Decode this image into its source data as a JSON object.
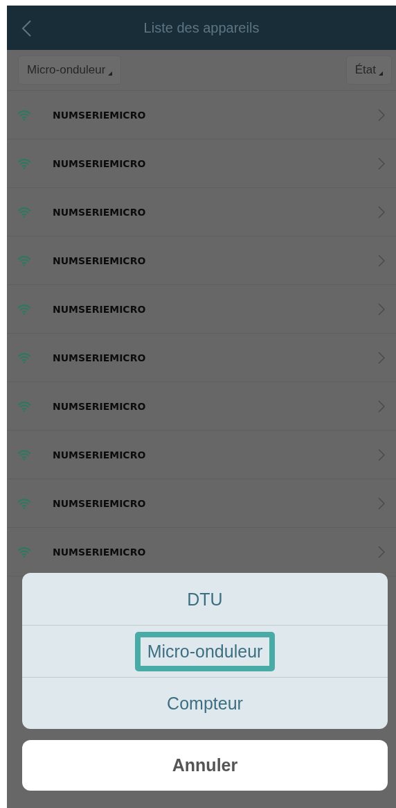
{
  "header": {
    "title": "Liste des appareils"
  },
  "filters": [
    {
      "label": "Micro-onduleur"
    },
    {
      "label": "État"
    }
  ],
  "devices": [
    {
      "name": "NUMSERIEMICRO"
    },
    {
      "name": "NUMSERIEMICRO"
    },
    {
      "name": "NUMSERIEMICRO"
    },
    {
      "name": "NUMSERIEMICRO"
    },
    {
      "name": "NUMSERIEMICRO"
    },
    {
      "name": "NUMSERIEMICRO"
    },
    {
      "name": "NUMSERIEMICRO"
    },
    {
      "name": "NUMSERIEMICRO"
    },
    {
      "name": "NUMSERIEMICRO"
    },
    {
      "name": "NUMSERIEMICRO"
    }
  ],
  "action_sheet": {
    "options": [
      {
        "label": "DTU",
        "selected": false
      },
      {
        "label": "Micro-onduleur",
        "selected": true
      },
      {
        "label": "Compteur",
        "selected": false
      }
    ],
    "cancel": "Annuler"
  }
}
